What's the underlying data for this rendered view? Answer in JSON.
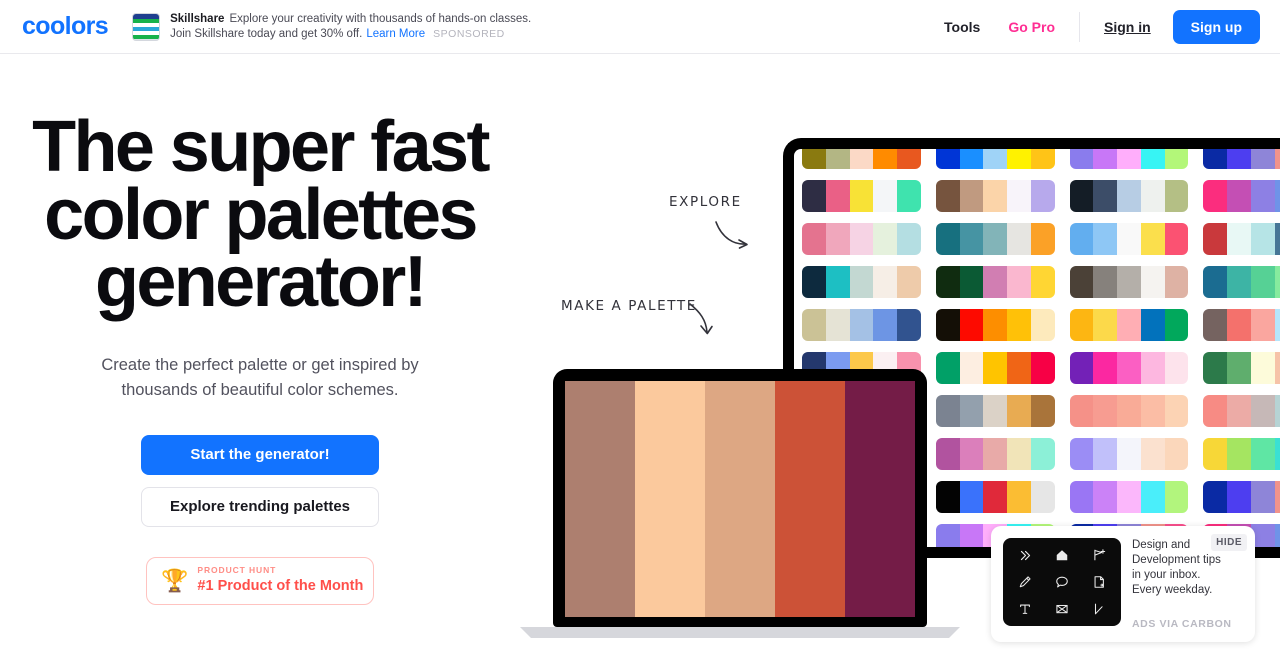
{
  "header": {
    "logo": "coolors",
    "promo": {
      "brand": "Skillshare",
      "line1": "Explore your creativity with thousands of hands-on classes.",
      "line2": "Join Skillshare today and get 30% off.",
      "learn_more": "Learn More",
      "sponsored": "SPONSORED"
    },
    "nav": {
      "tools": "Tools",
      "go_pro": "Go Pro",
      "sign_in": "Sign in",
      "sign_up": "Sign up"
    }
  },
  "hero": {
    "title_line1": "The super fast",
    "title_line2": "color palettes",
    "title_line3": "generator!",
    "subtitle": "Create the perfect palette or get inspired by thousands of beautiful color schemes.",
    "primary_button": "Start the generator!",
    "secondary_button": "Explore trending palettes",
    "product_hunt": {
      "kicker": "PRODUCT HUNT",
      "title": "#1 Product of the Month",
      "icon": "trophy-icon"
    }
  },
  "annotations": {
    "explore": "EXPLORE",
    "make_a_palette": "MAKE A PALETTE"
  },
  "colors": {
    "brand_blue": "#1273ff",
    "pro_pink": "#ff2e93",
    "product_hunt_red": "#ff4f4a",
    "text_dark": "#0b0b0f",
    "text_muted": "#52525e"
  },
  "laptop_palette": [
    "#ad7f6f",
    "#fbc99d",
    "#dda783",
    "#cc5237",
    "#741c47"
  ],
  "palette_grid": [
    [
      "#8a7a10",
      "#b3b684",
      "#fbd9c6",
      "#ff8b00",
      "#e8581f"
    ],
    [
      "#0035d6",
      "#1a8fff",
      "#9fd3f7",
      "#fff200",
      "#ffc417"
    ],
    [
      "#8a7ced",
      "#c877f7",
      "#ffaefb",
      "#37f4f4",
      "#b3f779"
    ],
    [
      "#0a2aa4",
      "#4d3ef0",
      "#8e85d8",
      "#f1938b",
      "#f94f8d"
    ],
    [
      "#2e2d44",
      "#ea6086",
      "#f8e236",
      "#f4f6f8",
      "#3fe3ae"
    ],
    [
      "#76543e",
      "#c09a80",
      "#fbd4a9",
      "#f8f4fa",
      "#b7a9ec"
    ],
    [
      "#141d26",
      "#3c4d68",
      "#b7cde4",
      "#eef1ee",
      "#b4bf85"
    ],
    [
      "#fb2d7e",
      "#c44fb4",
      "#8d80e4",
      "#6f93e8",
      "#39a6f7"
    ],
    [
      "#e4738f",
      "#f0a7bc",
      "#f6d3e4",
      "#e5f1dd",
      "#b4dee2"
    ],
    [
      "#17707f",
      "#4694a3",
      "#82b4b8",
      "#e6e5e1",
      "#fba127"
    ],
    [
      "#62aeef",
      "#8ec7f5",
      "#f9f9f9",
      "#fbdf4c",
      "#fb5272"
    ],
    [
      "#c9393c",
      "#e8f8f5",
      "#b6e4e6",
      "#467696",
      "#172c4c"
    ],
    [
      "#0d2a3e",
      "#1dbfc3",
      "#c3d8d2",
      "#f6eee6",
      "#eecbaa"
    ],
    [
      "#102c10",
      "#0b5a34",
      "#d17eb2",
      "#fab7cf",
      "#ffd633"
    ],
    [
      "#4b4137",
      "#86817c",
      "#b4afa9",
      "#f5f3f0",
      "#deb2a4"
    ],
    [
      "#1b6c91",
      "#3db4a5",
      "#56d195",
      "#86eb9e",
      "#c4f7c2"
    ],
    [
      "#cbc296",
      "#e5e3d5",
      "#a4c1e5",
      "#6d95e4",
      "#31538f"
    ],
    [
      "#140f06",
      "#fd0a00",
      "#fd8e00",
      "#ffc108",
      "#fdeabc"
    ],
    [
      "#fdb612",
      "#fcd94a",
      "#ffaeb4",
      "#0272bc",
      "#01a85c"
    ],
    [
      "#756360",
      "#f4716c",
      "#faa69f",
      "#b5e5fb",
      "#4a79f9"
    ],
    [
      "#24386d",
      "#7b9bf0",
      "#fcc84a",
      "#fbf0f2",
      "#f892ad"
    ],
    [
      "#01a067",
      "#fdeee1",
      "#ffc400",
      "#f06516",
      "#f70045"
    ],
    [
      "#7321b7",
      "#fb28a1",
      "#fb5fc3",
      "#fdb7e0",
      "#fde3ec"
    ],
    [
      "#2c7a4a",
      "#5fae6d",
      "#fdfbda",
      "#f6c3a8",
      "#d1832c"
    ],
    [
      "#6a6684",
      "#ab9dc7",
      "#b4c5de",
      "#d7f3ef",
      "#d8c695"
    ],
    [
      "#7b8391",
      "#93a0ad",
      "#dbd2c7",
      "#e8ab52",
      "#a9743a"
    ],
    [
      "#f59188",
      "#f79c91",
      "#f9ab97",
      "#fbbda5",
      "#fcd3b4"
    ],
    [
      "#f78b84",
      "#ecaba6",
      "#c6b8b7",
      "#b6d3d4",
      "#a5f3f5"
    ],
    [
      "#fb807c",
      "#e9aaa4",
      "#c8bcba",
      "#b7d4d4",
      "#a3f2f5"
    ],
    [
      "#b1539f",
      "#db7fbb",
      "#e8aaa8",
      "#f1e4b8",
      "#8cf0d7"
    ],
    [
      "#9b8df5",
      "#c1c0fa",
      "#f4f5fb",
      "#fbe1cf",
      "#fbd7bb"
    ],
    [
      "#f7d737",
      "#a5e561",
      "#5fe6a4",
      "#3ae0d4",
      "#21e8ec"
    ],
    [
      "#b4e1ee",
      "#f4a529",
      "#fbd452",
      "#4c8c2c",
      "#13491b"
    ],
    [
      "#030303",
      "#3a72fb",
      "#e0293a",
      "#fbbd33",
      "#e6e6e6"
    ],
    [
      "#9a76f4",
      "#cb82f7",
      "#fbb7fb",
      "#4aeefa",
      "#b2f57d"
    ],
    [
      "#0a2aa4",
      "#4d3ef0",
      "#8e85d8",
      "#f1938b",
      "#f94f8d"
    ],
    [
      "#0035d6",
      "#1a8fff",
      "#9fd3f7",
      "#fff200",
      "#ffc417"
    ],
    [
      "#8a7ced",
      "#c877f7",
      "#ffaefb",
      "#37f4f4",
      "#b3f779"
    ],
    [
      "#0a2aa4",
      "#4d3ef0",
      "#8e85d8",
      "#f1938b",
      "#f94f8d"
    ],
    [
      "#fb2d7e",
      "#c44fb4",
      "#8d80e4",
      "#6f93e8",
      "#39a6f7"
    ],
    [
      "#76543e",
      "#c09a80",
      "#fbd4a9",
      "#f8f4fa",
      "#b7a9ec"
    ],
    [
      "#17707f",
      "#4694a3",
      "#82b4b8",
      "#e6e5e1",
      "#fba127"
    ],
    [
      "#62aeef",
      "#8ec7f5",
      "#f9f9f9",
      "#fbdf4c",
      "#fb5272"
    ],
    [
      "#c9393c",
      "#e8f8f5",
      "#b6e4e6",
      "#467696",
      "#172c4c"
    ]
  ],
  "carbon_ad": {
    "text_line1": "Design and",
    "text_line2": "Development tips",
    "text_line3": "in your inbox.",
    "text_line4": "Every weekday.",
    "credit": "ADS VIA CARBON",
    "hide_label": "HIDE",
    "icons": [
      "chevrons-right-icon",
      "home-icon",
      "flag-plus-icon",
      "pen-icon",
      "speech-bubble-icon",
      "page-icon",
      "text-icon",
      "envelope-x-icon",
      "corner-line-icon"
    ]
  }
}
